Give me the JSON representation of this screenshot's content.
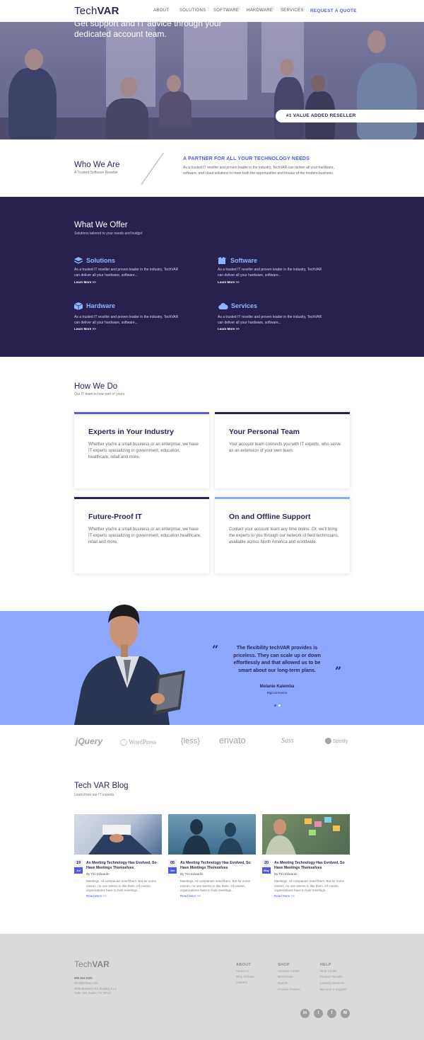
{
  "header": {
    "logo_light": "Tech",
    "logo_bold": "VAR",
    "nav": [
      "ABOUT",
      "SOLUTIONS",
      "SOFTWARE",
      "HARDWARE",
      "SERVICES"
    ],
    "cta": "REQUEST A QUOTE"
  },
  "hero": {
    "title": "Get support and IT advice through your dedicated account team.",
    "badge": "#1 VALUE ADDED RESELLER"
  },
  "who": {
    "title": "Who We Are",
    "subtitle": "A Trusted Software Reseller",
    "heading": "A PARTNER FOR ALL YOUR TECHNOLOGY NEEDS",
    "text": "As a trusted IT reseller and proven leader in the industry, TechVAR can deliver all your hardware, software, and cloud solutions to meet both the opportunities and threats of the modern business."
  },
  "offer": {
    "title": "What We Offer",
    "subtitle": "Solutions tailored to your needs and budget",
    "items": [
      {
        "title": "Solutions",
        "icon": "layers-icon",
        "desc": "As a trusted IT reseller and proven leader in the industry, TechVAR can deliver all your hardware, software...",
        "link": "Learn More >>"
      },
      {
        "title": "Software",
        "icon": "box-open-icon",
        "desc": "As a trusted IT reseller and proven leader in the industry, TechVAR can deliver all your hardware, software...",
        "link": "Learn More >>"
      },
      {
        "title": "Hardware",
        "icon": "cube-icon",
        "desc": "As a trusted IT reseller and proven leader in the industry, TechVAR can deliver all your hardware, software...",
        "link": "Learn More >>"
      },
      {
        "title": "Services",
        "icon": "cloud-icon",
        "desc": "As a trusted IT reseller and proven leader in the industry, TechVAR can deliver all your hardware, software...",
        "link": "Learn More >>"
      }
    ]
  },
  "how": {
    "title": "How We Do",
    "subtitle": "Our IT team is now part of yours",
    "cards": [
      {
        "title": "Experts in Your Industry",
        "text": "Whether you're a small business or an enterprise, we have IT experts specializing in government, education, healthcare, retail and more.",
        "accent": "#5b5be6"
      },
      {
        "title": "Your Personal Team",
        "text": "Your account team connects you with IT experts, who serve as an extension of your own team.",
        "accent": "#28214f"
      },
      {
        "title": "Future-Proof IT",
        "text": "Whether you're a small business or an enterprise, we have IT experts specializing in government, education,healthcare, retail and more.",
        "accent": "#2b2555"
      },
      {
        "title": "On and Offline Support",
        "text": "Contact your account team any time online. Or, we'll bring the experts to you through our network of field technicians, available across North America and worldwide.",
        "accent": "#8ba8fd"
      }
    ]
  },
  "testimonial": {
    "open_quote": "“",
    "close_quote": "”",
    "quote": "The flexibility techVAR provides is priceless. They can scale up or down effortlessly and that allowed us to be smart about our long-term plans.",
    "name": "Melanie Kalemba",
    "company": "BigCommerce",
    "active_slide": 1,
    "slides": 2
  },
  "partners": [
    "jQuery",
    "WordPress",
    "{less}",
    "envato",
    "Sass",
    "Spotify"
  ],
  "blog": {
    "title": "Tech VAR Blog",
    "subtitle": "Learn from our IT experts",
    "posts": [
      {
        "day": "19",
        "month": "Jul",
        "title": "As Meeting Technology Has Evolved, So Have Meetings Themselves",
        "author": "By Tim Edwards",
        "excerpt": "Meetings. All companies need them. But for some reason, no one seems to like them. Of course, organizations have to hold meetings...",
        "link": "Read More >>"
      },
      {
        "day": "05",
        "month": "Jun",
        "title": "As Meeting Technology Has Evolved, So Have Meetings Themselves",
        "author": "By Tim Edwards",
        "excerpt": "Meetings. All companies need them. But for some reason, no one seems to like them. Of course, organizations have to hold meetings...",
        "link": "Read More >>"
      },
      {
        "day": "20",
        "month": "May",
        "title": "As Meeting Technology Has Evolved, So Have Meetings Themselves",
        "author": "By Tim Edwards",
        "excerpt": "Meetings. All companies need them. But for some reason, no one seems to like them. Of course, organizations have to hold meetings...",
        "link": "Read More >>"
      }
    ]
  },
  "footer": {
    "logo_light": "Tech",
    "logo_bold": "VAR",
    "phone": "888 464 3320",
    "email": "info@techvar.com",
    "address1": "4606 Burleson Rd, Building 5 LL",
    "address2": "Suite 150, Austin, TX 78744",
    "columns": [
      {
        "heading": "ABOUT",
        "links": [
          "About Us",
          "Why Techvar",
          "Careers"
        ]
      },
      {
        "heading": "SHOP",
        "links": [
          "Account Center",
          "Best Deals",
          "Brands",
          "Product Finders"
        ]
      },
      {
        "heading": "HELP",
        "links": [
          "Help Center",
          "Product Recalls",
          "Leasing Services",
          "Become a Supplier"
        ]
      }
    ],
    "social": [
      "in",
      "t",
      "f",
      "M"
    ]
  }
}
